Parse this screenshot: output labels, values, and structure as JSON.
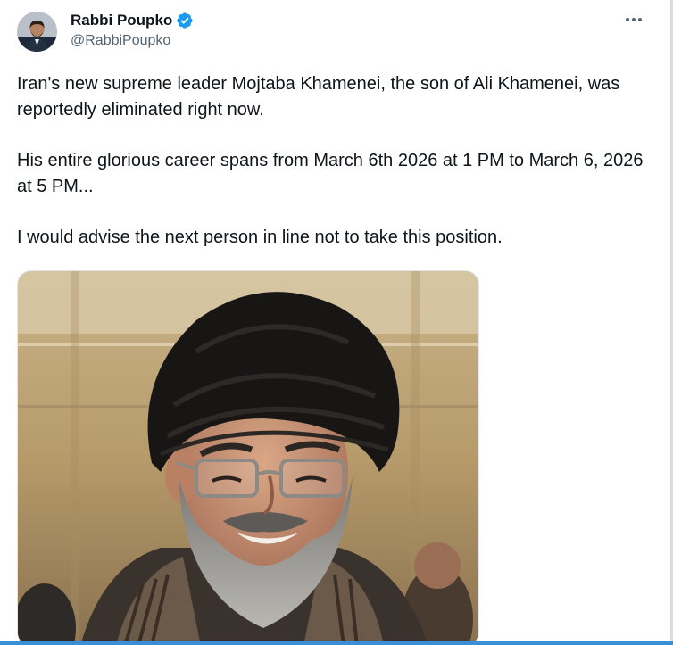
{
  "author": {
    "display_name": "Rabbi Poupko",
    "handle": "@RabbiPoupko",
    "verified_color": "#1d9bf0"
  },
  "tweet": {
    "paragraphs": [
      "Iran's new supreme leader Mojtaba Khamenei, the son of Ali Khamenei, was reportedly eliminated right now.",
      "His entire glorious career spans from March 6th 2026 at 1 PM to March 6, 2026 at 5 PM...",
      "I would advise the next person in line not to take this position."
    ]
  },
  "icons": {
    "more": "more-options-icon",
    "verified": "verified-badge-icon"
  },
  "colors": {
    "text_primary": "#0f1419",
    "text_secondary": "#536471",
    "accent": "#1d9bf0"
  }
}
